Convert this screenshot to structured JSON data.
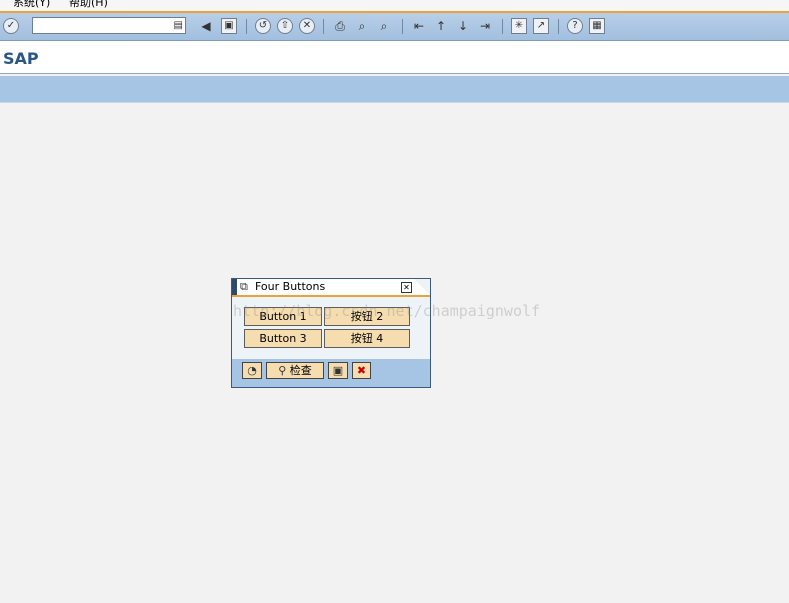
{
  "menu": {
    "items": [
      {
        "label": "系统(Y)"
      },
      {
        "label": "帮助(H)"
      }
    ]
  },
  "toolbar": {
    "command_field_value": "",
    "icons": [
      "enter-icon",
      "dropdown-icon",
      "back-icon",
      "save-icon",
      "back-circle-icon",
      "exit-icon",
      "cancel-icon",
      "print-icon",
      "find-icon",
      "find-next-icon",
      "first-page-icon",
      "previous-page-icon",
      "next-page-icon",
      "last-page-icon",
      "new-session-icon",
      "shortcut-icon",
      "help-icon",
      "layout-menu-icon"
    ]
  },
  "title": "SAP",
  "dialog": {
    "title": "Four Buttons",
    "buttons": [
      {
        "label": "Button 1"
      },
      {
        "label": "按钮 2"
      },
      {
        "label": "Button 3"
      },
      {
        "label": "按钮 4"
      }
    ],
    "watermark": "http://blog.csdn.net/champaignwolf",
    "footer": {
      "check_label": "检查"
    }
  },
  "colors": {
    "toolbar_blue": "#a6c4e4",
    "accent_orange": "#e8a33c",
    "button_fill": "#f5ddb0",
    "title_blue": "#2a5686"
  }
}
